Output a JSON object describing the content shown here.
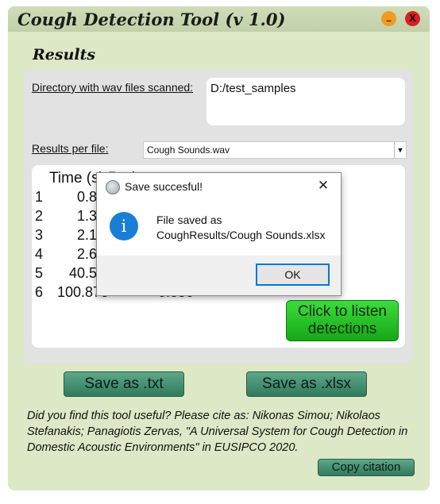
{
  "window": {
    "title": "Cough Detection Tool (v 1.0)",
    "minimize_glyph": "_",
    "close_glyph": "X",
    "colors": {
      "background": "#dce8c6",
      "minimize": "#f19a1f",
      "close": "#d91f26"
    }
  },
  "results": {
    "section_title": "Results",
    "directory_label": "Directory with wav files scanned:",
    "directory_value": "D:/test_samples",
    "per_file_label": "Results per file:",
    "selected_file": "Cough Sounds.wav",
    "table_header": "Time (s)   Prob.",
    "rows": [
      {
        "index": "1",
        "time": "0.88",
        "prob": ""
      },
      {
        "index": "2",
        "time": "1.30",
        "prob": ""
      },
      {
        "index": "3",
        "time": "2.13",
        "prob": ""
      },
      {
        "index": "4",
        "time": "2.61",
        "prob": ""
      },
      {
        "index": "5",
        "time": "40.59",
        "prob": ""
      },
      {
        "index": "6",
        "time": "100.875",
        "prob": "0.850"
      }
    ],
    "listen_button": "Click to listen detections"
  },
  "actions": {
    "save_txt": "Save as .txt",
    "save_xlsx": "Save as .xlsx"
  },
  "citation": {
    "text": "Did you find this tool useful? Please cite as: Nikonas Simou; Nikolaos Stefanakis; Panagiotis Zervas, \"A Universal System for Cough Detection in Domestic Acoustic Environments\" in EUSIPCO 2020.",
    "copy_button": "Copy citation"
  },
  "dialog": {
    "title": "Save succesful!",
    "close_glyph": "✕",
    "message_line1": "File saved as",
    "message_line2": "CoughResults/Cough Sounds.xlsx",
    "info_glyph": "i",
    "ok_button": "OK"
  }
}
